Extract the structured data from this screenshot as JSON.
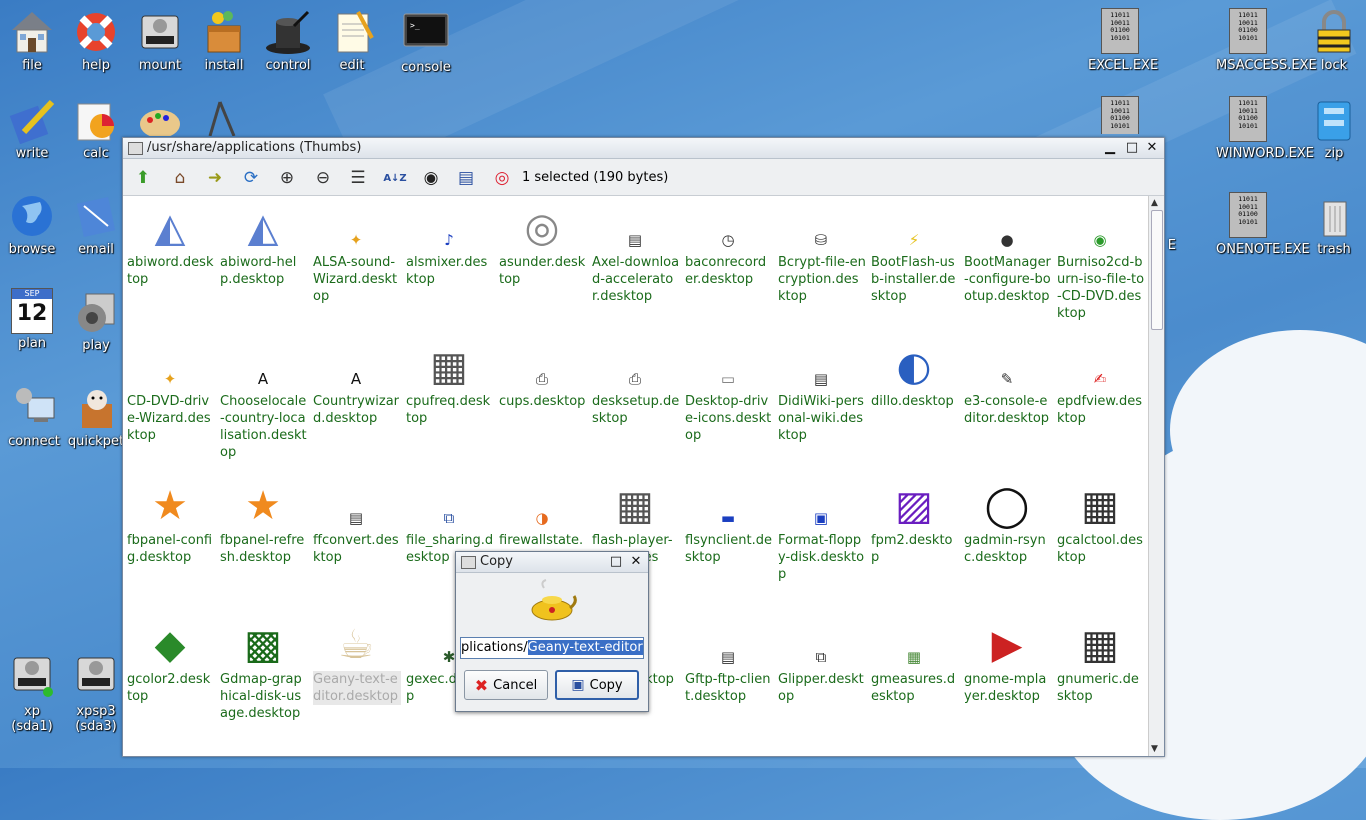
{
  "desktop": {
    "left_icons": [
      {
        "label": "file",
        "icon": "house-icon"
      },
      {
        "label": "help",
        "icon": "lifebuoy-icon"
      },
      {
        "label": "mount",
        "icon": "harddisk-icon"
      },
      {
        "label": "install",
        "icon": "package-icon"
      },
      {
        "label": "control",
        "icon": "tophat-icon"
      },
      {
        "label": "edit",
        "icon": "notepad-icon"
      },
      {
        "label": "console",
        "icon": "terminal-icon"
      },
      {
        "label": "write",
        "icon": "pen-document-icon"
      },
      {
        "label": "calc",
        "icon": "spreadsheet-icon"
      },
      {
        "label": "browse",
        "icon": "globe-icon"
      },
      {
        "label": "email",
        "icon": "mail-icon"
      },
      {
        "label": "plan",
        "icon": "calendar-icon"
      },
      {
        "label": "play",
        "icon": "speaker-icon"
      },
      {
        "label": "connect",
        "icon": "network-icon"
      },
      {
        "label": "quickpet",
        "icon": "pet-box-icon"
      },
      {
        "label": "xp\n(sda1)",
        "icon": "harddisk-icon"
      },
      {
        "label": "xpsp3\n(sda3)",
        "icon": "harddisk-icon"
      }
    ],
    "right_icons": [
      {
        "label": "EXCEL.EXE",
        "icon": "binary-file-icon"
      },
      {
        "label": "MSACCESS.EXE",
        "icon": "binary-file-icon"
      },
      {
        "label": "lock",
        "icon": "padlock-icon"
      },
      {
        "label": "WINWORD.EXE",
        "icon": "binary-file-icon"
      },
      {
        "label": "zip",
        "icon": "archive-icon"
      },
      {
        "label": "ONENOTE.EXE",
        "icon": "binary-file-icon"
      },
      {
        "label": "trash",
        "icon": "trash-icon"
      },
      {
        "label": "E",
        "icon": ""
      }
    ],
    "calendar_month": "SEP",
    "calendar_day": "12",
    "binary_text": "11011\n10011\n01100\n10101"
  },
  "window": {
    "title": "/usr/share/applications (Thumbs)",
    "status": "1 selected (190 bytes)",
    "toolbar": [
      "up-arrow-icon",
      "home-icon",
      "goto-icon",
      "refresh-icon",
      "zoom-in-icon",
      "zoom-out-icon",
      "list-view-icon",
      "sort-az-icon",
      "eye-icon",
      "details-view-icon",
      "help-lifebuoy-icon"
    ],
    "files": [
      "abiword.desktop",
      "abiword-help.desktop",
      "ALSA-sound-Wizard.desktop",
      "alsmixer.desktop",
      "asunder.desktop",
      "Axel-download-accelerator.desktop",
      "baconrecorder.desktop",
      "Bcrypt-file-encryption.desktop",
      "BootFlash-usb-installer.desktop",
      "BootManager-configure-bootup.desktop",
      "Burniso2cd-burn-iso-file-to-CD-DVD.desktop",
      "CD-DVD-drive-Wizard.desktop",
      "Chooselocale-country-localisation.desktop",
      "Countrywizard.desktop",
      "cpufreq.desktop",
      "cups.desktop",
      "desksetup.desktop",
      "Desktop-drive-icons.desktop",
      "DidiWiki-personal-wiki.desktop",
      "dillo.desktop",
      "e3-console-editor.desktop",
      "epdfview.desktop",
      "fbpanel-config.desktop",
      "fbpanel-refresh.desktop",
      "ffconvert.desktop",
      "file_sharing.desktop",
      "firewallstate.desktop",
      "flash-player-properties",
      "flsynclient.desktop",
      "Format-floppy-disk.desktop",
      "fpm2.desktop",
      "gadmin-rsync.desktop",
      "gcalctool.desktop",
      "gcolor2.desktop",
      "Gdmap-graphical-disk-usage.desktop",
      "Geany-text-editor.desktop",
      "gexec.desktop",
      "",
      "gftp.desktop",
      "Gftp-ftp-client.desktop",
      "Glipper.desktop",
      "gmeasures.desktop",
      "gnome-mplayer.desktop",
      "gnumeric.desktop"
    ]
  },
  "dialog": {
    "title": "Copy",
    "input_prefix": "plications/",
    "input_selected": "Geany-text-editor",
    "cancel_label": "Cancel",
    "copy_label": "Copy"
  }
}
